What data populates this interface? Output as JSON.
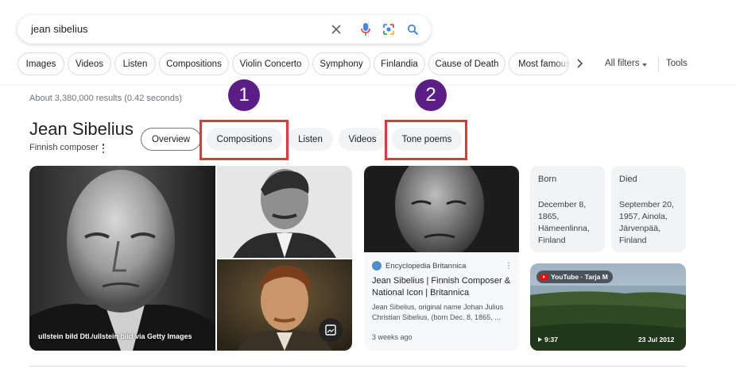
{
  "search": {
    "query": "jean sibelius",
    "icons": [
      "clear-icon",
      "microphone-icon",
      "lens-icon",
      "search-icon"
    ]
  },
  "filters": {
    "chips": [
      "Images",
      "Videos",
      "Listen",
      "Compositions",
      "Violin Concerto",
      "Symphony",
      "Finlandia",
      "Cause of Death",
      "Most famous"
    ],
    "all_filters": "All filters",
    "tools": "Tools"
  },
  "results": {
    "stats": "About 3,380,000 results (0.42 seconds)"
  },
  "entity": {
    "title": "Jean Sibelius",
    "subtitle": "Finnish composer",
    "tabs": [
      "Overview",
      "Compositions",
      "Listen",
      "Videos",
      "Tone poems"
    ],
    "active_tab": "Overview"
  },
  "annotations": {
    "badge_1": "1",
    "badge_2": "2",
    "highlight_color": "#e8343a",
    "badge_color": "#5b1e86"
  },
  "images": {
    "main_credit": "ullstein bild Dtl./ullstein bild via Getty Images"
  },
  "britannica": {
    "source": "Encyclopedia Britannica",
    "title": "Jean Sibelius | Finnish Composer & National Icon | Britannica",
    "snippet": "Jean Sibelius, original name Johan Julius Christian Sibelius, (born Dec. 8, 1865, ...",
    "age": "3 weeks ago"
  },
  "facts": {
    "born_label": "Born",
    "born_value": "December 8, 1865, Hämeenlinna, Finland",
    "died_label": "Died",
    "died_value": "September 20, 1957, Ainola, Järvenpää, Finland"
  },
  "video": {
    "channel": "YouTube · Tarja M",
    "duration": "9:37",
    "date": "23 Jul 2012"
  }
}
